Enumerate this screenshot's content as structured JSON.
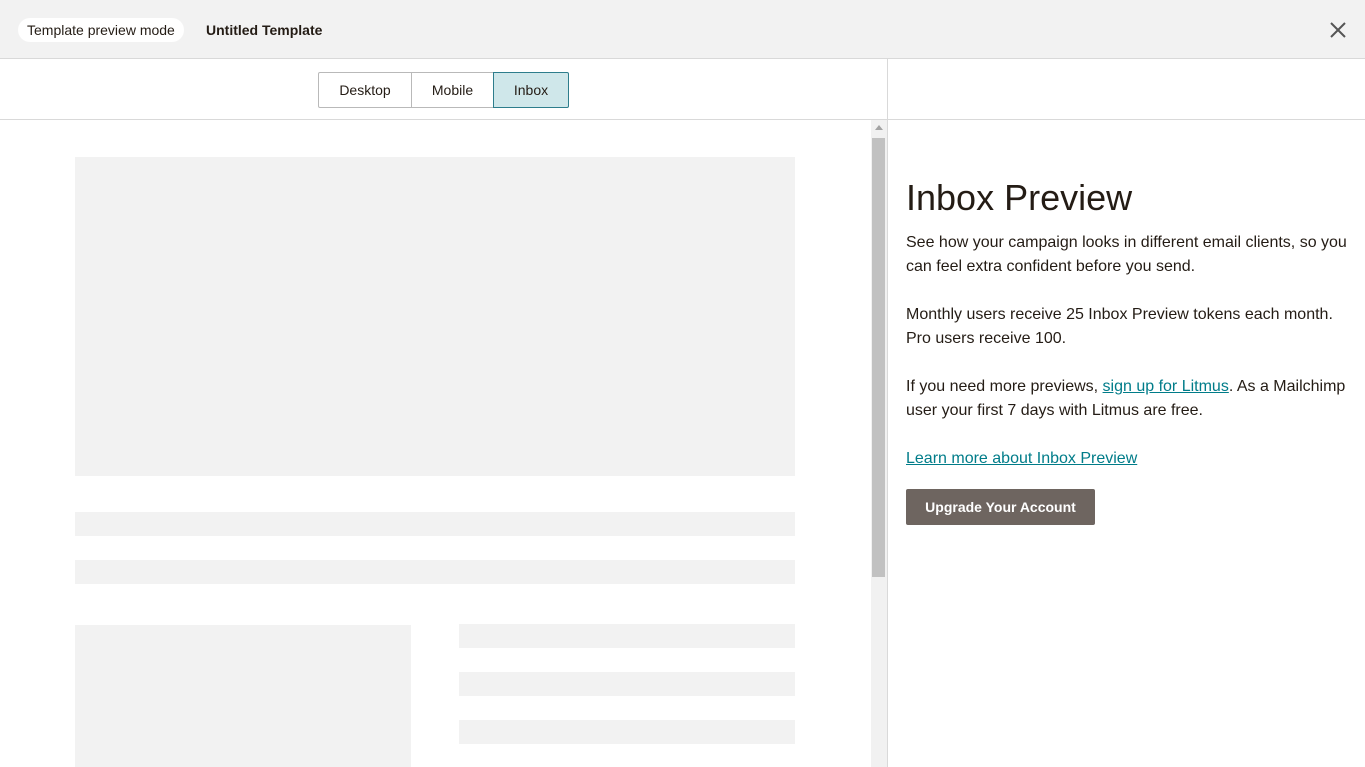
{
  "header": {
    "mode_label": "Template preview mode",
    "template_title": "Untitled Template",
    "close_icon": "close-icon"
  },
  "view_tabs": [
    {
      "label": "Desktop",
      "active": false
    },
    {
      "label": "Mobile",
      "active": false
    },
    {
      "label": "Inbox",
      "active": true
    }
  ],
  "sidebar": {
    "title": "Inbox Preview",
    "p1": "See how your campaign looks in different email clients, so you can feel extra confident before you send.",
    "p2": "Monthly users receive 25 Inbox Preview tokens each month. Pro users receive 100.",
    "p3_before": "If you need more previews, ",
    "p3_link": "sign up for Litmus",
    "p3_after": ". As a Mailchimp user your first 7 days with Litmus are free.",
    "learn_more_link": "Learn more about Inbox Preview",
    "upgrade_button": "Upgrade Your Account"
  },
  "colors": {
    "accent": "#007c89",
    "active_tab_bg": "#cfe7ea",
    "button_bg": "#6e6560",
    "placeholder": "#f2f2f2"
  }
}
